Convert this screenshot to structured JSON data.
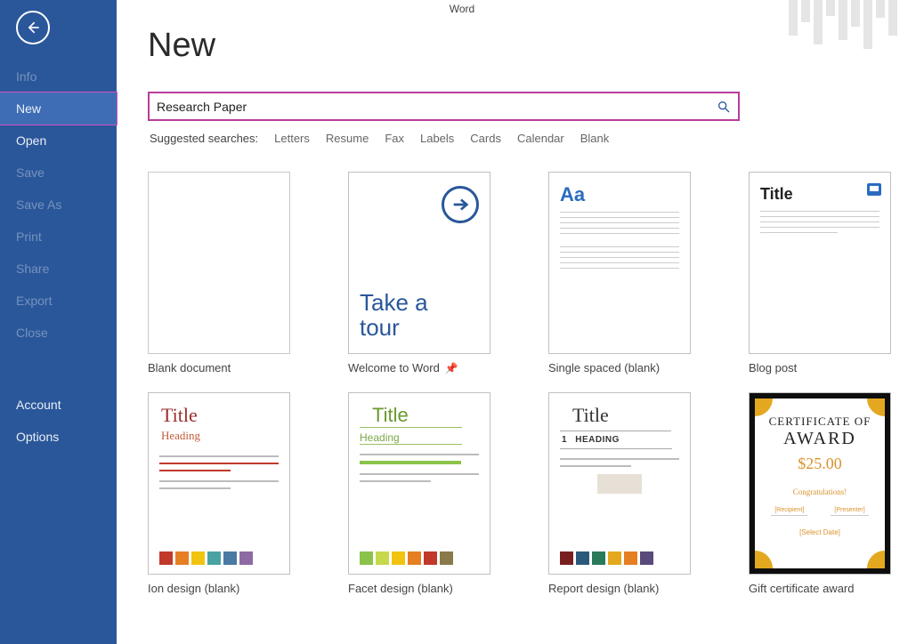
{
  "app_title": "Word",
  "sidebar": {
    "items": [
      {
        "label": "Info",
        "dim": true
      },
      {
        "label": "New",
        "active": true
      },
      {
        "label": "Open"
      },
      {
        "label": "Save",
        "dim": true
      },
      {
        "label": "Save As",
        "dim": true
      },
      {
        "label": "Print",
        "dim": true
      },
      {
        "label": "Share",
        "dim": true
      },
      {
        "label": "Export",
        "dim": true
      },
      {
        "label": "Close",
        "dim": true
      }
    ],
    "footer": [
      {
        "label": "Account"
      },
      {
        "label": "Options"
      }
    ]
  },
  "page_title": "New",
  "search": {
    "value": "Research Paper"
  },
  "suggested": {
    "label": "Suggested searches:",
    "items": [
      "Letters",
      "Resume",
      "Fax",
      "Labels",
      "Cards",
      "Calendar",
      "Blank"
    ]
  },
  "templates_row1": [
    {
      "caption": "Blank document"
    },
    {
      "caption": "Welcome to Word",
      "pinned": true,
      "tour_line1": "Take a",
      "tour_line2": "tour"
    },
    {
      "caption": "Single spaced (blank)",
      "aa": "Aa"
    },
    {
      "caption": "Blog post",
      "title": "Title"
    }
  ],
  "templates_row2": [
    {
      "caption": "Ion design (blank)",
      "title": "Title",
      "heading": "Heading",
      "swatches": [
        "#c0392b",
        "#e67e22",
        "#f1c40f",
        "#4aa3a3",
        "#4a7aa3",
        "#8e6aa3"
      ]
    },
    {
      "caption": "Facet design (blank)",
      "title": "Title",
      "heading": "Heading",
      "swatches": [
        "#8bc34a",
        "#c5d94a",
        "#f1c40f",
        "#e67e22",
        "#c0392b",
        "#8a7a4a"
      ]
    },
    {
      "caption": "Report design (blank)",
      "title": "Title",
      "num": "1",
      "heading": "Heading",
      "swatches": [
        "#7a1f1f",
        "#2a5a7a",
        "#2a7a5a",
        "#e3a81f",
        "#e67e22",
        "#5a4a7a"
      ]
    },
    {
      "caption": "Gift certificate award",
      "t1": "CERTIFICATE OF",
      "t2": "AWARD",
      "price": "$25.00",
      "congrats": "Congratulations!",
      "s1": "[Recipient]",
      "s2": "[Presenter]",
      "date": "[Select Date]"
    }
  ]
}
